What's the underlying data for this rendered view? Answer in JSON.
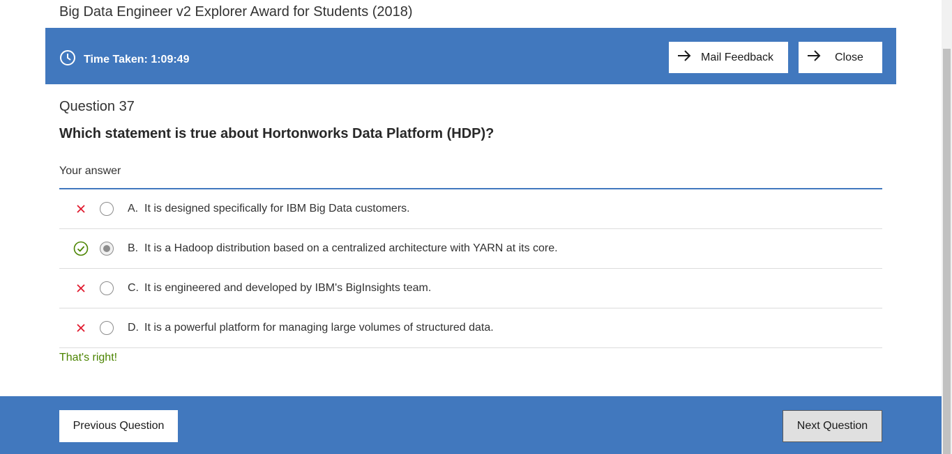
{
  "page": {
    "title": "Big Data Engineer v2 Explorer Award for Students (2018)"
  },
  "header": {
    "timer_icon": "clock-icon",
    "time_taken": "Time Taken: 1:09:49",
    "mail_feedback_label": "Mail Feedback",
    "close_label": "Close",
    "button_icon": "arrow-right-icon",
    "bar_color": "#4178be"
  },
  "question": {
    "number": "Question 37",
    "text": "Which statement is true about Hortonworks Data Platform (HDP)?",
    "your_answer_label": "Your answer",
    "options": [
      {
        "letter": "A.",
        "text": "It is designed specifically for IBM Big Data customers.",
        "status": "incorrect",
        "selected": false
      },
      {
        "letter": "B.",
        "text": "It is a Hadoop distribution based on a centralized architecture with YARN at its core.",
        "status": "correct",
        "selected": true
      },
      {
        "letter": "C.",
        "text": "It is engineered and developed by IBM's BigInsights team.",
        "status": "incorrect",
        "selected": false
      },
      {
        "letter": "D.",
        "text": "It is a powerful platform for managing large volumes of structured data.",
        "status": "incorrect",
        "selected": false
      }
    ],
    "feedback": "That's right!"
  },
  "footer": {
    "previous_label": "Previous Question",
    "next_label": "Next Question"
  },
  "colors": {
    "accent": "#4178be",
    "correct": "#4b8400",
    "incorrect": "#e0182d"
  }
}
